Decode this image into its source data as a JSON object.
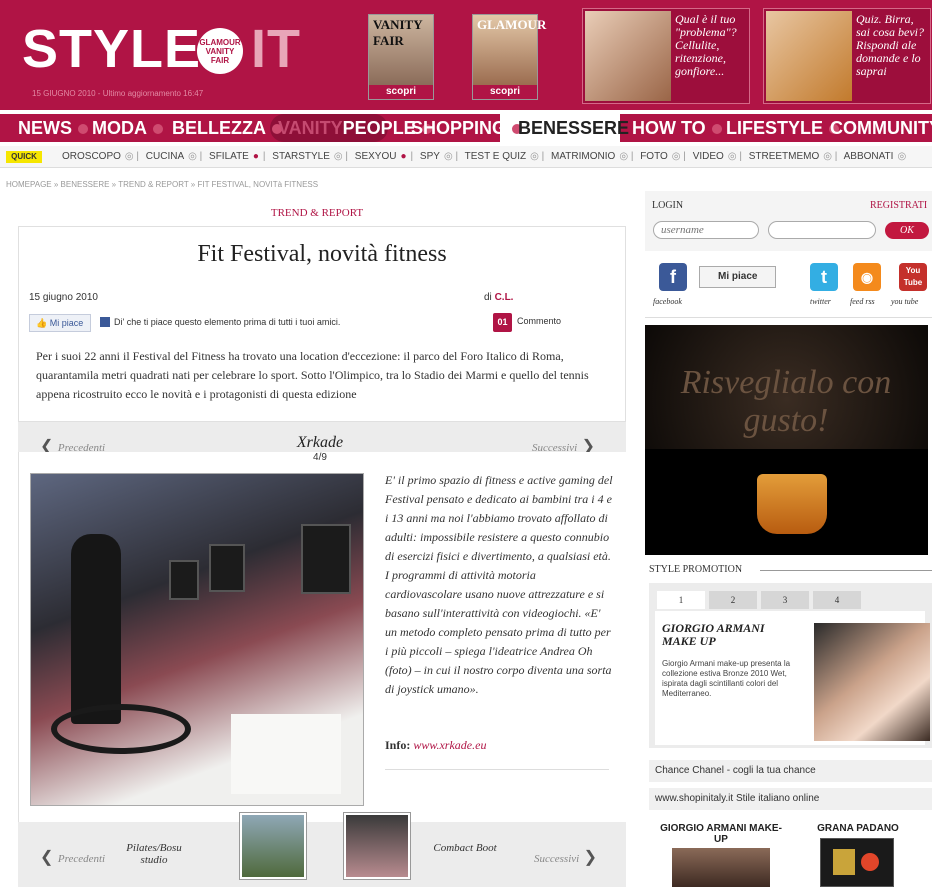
{
  "header": {
    "logo": "STYLE",
    "logo_it": "IT",
    "logo_badge": "GLAMOUR VANITY FAIR",
    "date_line": "15 GIUGNO 2010 - Ultimo aggiornamento 16:47",
    "magazines": [
      {
        "title": "VANITY FAIR",
        "cta": "scopri"
      },
      {
        "title": "GLAMOUR",
        "cta": "scopri"
      }
    ],
    "promos": [
      {
        "text": "Qual è il tuo \"problema\"? Cellulite, ritenzione, gonfiore..."
      },
      {
        "text": "Quiz. Birra, sai cosa bevi? Rispondi ale domande e lo saprai"
      }
    ]
  },
  "nav": {
    "items": [
      "NEWS",
      "MODA",
      "BELLEZZA",
      "VANITY",
      "PEOPLE",
      "SHOPPING",
      "BENESSERE",
      "HOW TO",
      "LIFESTYLE",
      "COMMUNITY"
    ],
    "active": "BENESSERE"
  },
  "quick": {
    "label": "QUICK",
    "links": [
      "OROSCOPO",
      "CUCINA",
      "SFILATE",
      "STARSTYLE",
      "SEXYOU",
      "SPY",
      "TEST E QUIZ",
      "MATRIMONIO",
      "FOTO",
      "VIDEO",
      "STREETMEMO",
      "ABBONATI"
    ]
  },
  "breadcrumb": "HOMEPAGE » BENESSERE » TREND & REPORT » FIT FESTIVAL, NOVITà FITNESS",
  "article": {
    "section": "TREND & REPORT",
    "title": "Fit Festival, novità fitness",
    "date": "15 giugno 2010",
    "author_prefix": "di",
    "author": "C.L.",
    "like_button": "Mi piace",
    "like_text": "Di' che ti piace questo elemento prima di tutti i tuoi amici.",
    "comment_count": "01",
    "comment_label": "Commento",
    "intro": "Per i suoi 22 anni il Festival del Fitness ha trovato una location d'eccezione: il parco del Foro Italico di Roma, quarantamila metri quadrati nati per celebrare lo sport. Sotto l'Olimpico, tra lo Stadio dei Marmi e quello del tennis appena ricostruito ecco le novità e i protagonisti di questa edizione"
  },
  "gallery": {
    "prev": "Precedenti",
    "next": "Successivi",
    "title": "Xrkade",
    "count": "4/9",
    "text": "E' il primo spazio di fitness e active gaming del Festival pensato e dedicato ai bambini tra i 4 e i 13 anni ma noi l'abbiamo trovato affollato di adulti: impossibile resistere a questo connubio di esercizi fisici e divertimento, a qualsiasi età. I programmi di attività motoria cardiovascolare usano nuove attrezzature e si basano sull'interattività con videogiochi. «E' un metodo completo pensato prima di tutto per i più piccoli – spiega l'ideatrice Andrea Oh (foto) – in cui il nostro corpo diventa una sorta di joystick umano».",
    "info_label": "Info:",
    "info_link": "www.xrkade.eu",
    "prev_item": "Pilates/Bosu studio",
    "next_item": "Combact Boot"
  },
  "sidebar": {
    "login_label": "LOGIN",
    "register_label": "REGISTRATI",
    "username_placeholder": "username",
    "ok": "OK",
    "fb_like": "Mi piace",
    "social": [
      {
        "name": "facebook",
        "glyph": "f",
        "color": "#3b5998"
      },
      {
        "name": "twitter",
        "glyph": "t",
        "color": "#33aee3"
      },
      {
        "name": "feed rss",
        "glyph": "◉",
        "color": "#f48a1c"
      },
      {
        "name": "you tube",
        "glyph": "You Tube",
        "color": "#c4302b"
      }
    ],
    "ad_text": "Risveglialo con gusto!",
    "style_promotion": "STYLE PROMOTION",
    "promo_tabs": [
      "1",
      "2",
      "3",
      "4"
    ],
    "promo_title": "GIORGIO ARMANI MAKE UP",
    "promo_desc": "Giorgio Armani make-up presenta la collezione estiva Bronze 2010 Wet, ispirata dagli scintillanti colori del Mediterraneo.",
    "links": [
      "Chance Chanel - cogli la tua chance",
      "www.shopinitaly.it Stile italiano online"
    ],
    "bottom_titles": [
      "GIORGIO ARMANI MAKE-UP",
      "GRANA PADANO"
    ]
  }
}
